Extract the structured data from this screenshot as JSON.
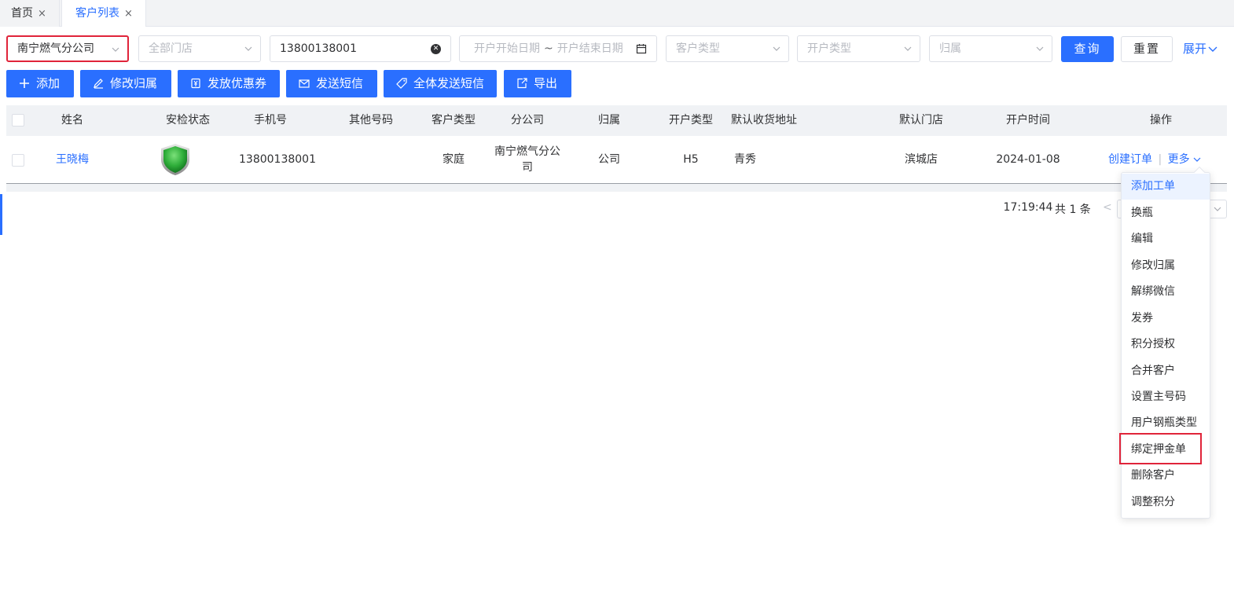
{
  "tabs": [
    {
      "label": "首页",
      "close": "×"
    },
    {
      "label": "客户列表",
      "close": "×"
    }
  ],
  "filters": {
    "company": "南宁燃气分公司",
    "store_placeholder": "全部门店",
    "phone_value": "13800138001",
    "date_start_placeholder": "开户开始日期",
    "date_sep": "~",
    "date_end_placeholder": "开户结束日期",
    "customer_type_placeholder": "客户类型",
    "open_type_placeholder": "开户类型",
    "belong_placeholder": "归属",
    "query_label": "查询",
    "reset_label": "重置",
    "expand_label": "展开"
  },
  "actions": {
    "add": "添加",
    "edit_belong": "修改归属",
    "issue_coupon": "发放优惠券",
    "send_sms": "发送短信",
    "send_sms_all": "全体发送短信",
    "export": "导出"
  },
  "table": {
    "columns": [
      "姓名",
      "安检状态",
      "手机号",
      "其他号码",
      "客户类型",
      "分公司",
      "归属",
      "开户类型",
      "默认收货地址",
      "默认门店",
      "开户时间",
      "操作"
    ],
    "rows": [
      {
        "name": "王晓梅",
        "inspection_icon": "green-shield-icon",
        "phone": "13800138001",
        "other_phone": "",
        "customer_type": "家庭",
        "branch": "南宁燃气分公司",
        "belong": "公司",
        "open_type": "H5",
        "address": "青秀",
        "store": "滨城店",
        "open_time": "2024-01-08 17:19:44",
        "op_create": "创建订单",
        "op_sep": "|",
        "op_more": "更多"
      }
    ]
  },
  "pagination": {
    "total": "共 1 条",
    "prev": "<"
  },
  "more_menu": {
    "items": [
      "添加工单",
      "换瓶",
      "编辑",
      "修改归属",
      "解绑微信",
      "发券",
      "积分授权",
      "合并客户",
      "设置主号码",
      "用户钢瓶类型",
      "绑定押金单",
      "删除客户",
      "调整积分"
    ],
    "active_index": 0,
    "highlighted_item": "绑定押金单"
  },
  "colors": {
    "primary": "#2a6fff",
    "highlight_border": "#e0243a",
    "shield_green": "#2fae3a"
  }
}
